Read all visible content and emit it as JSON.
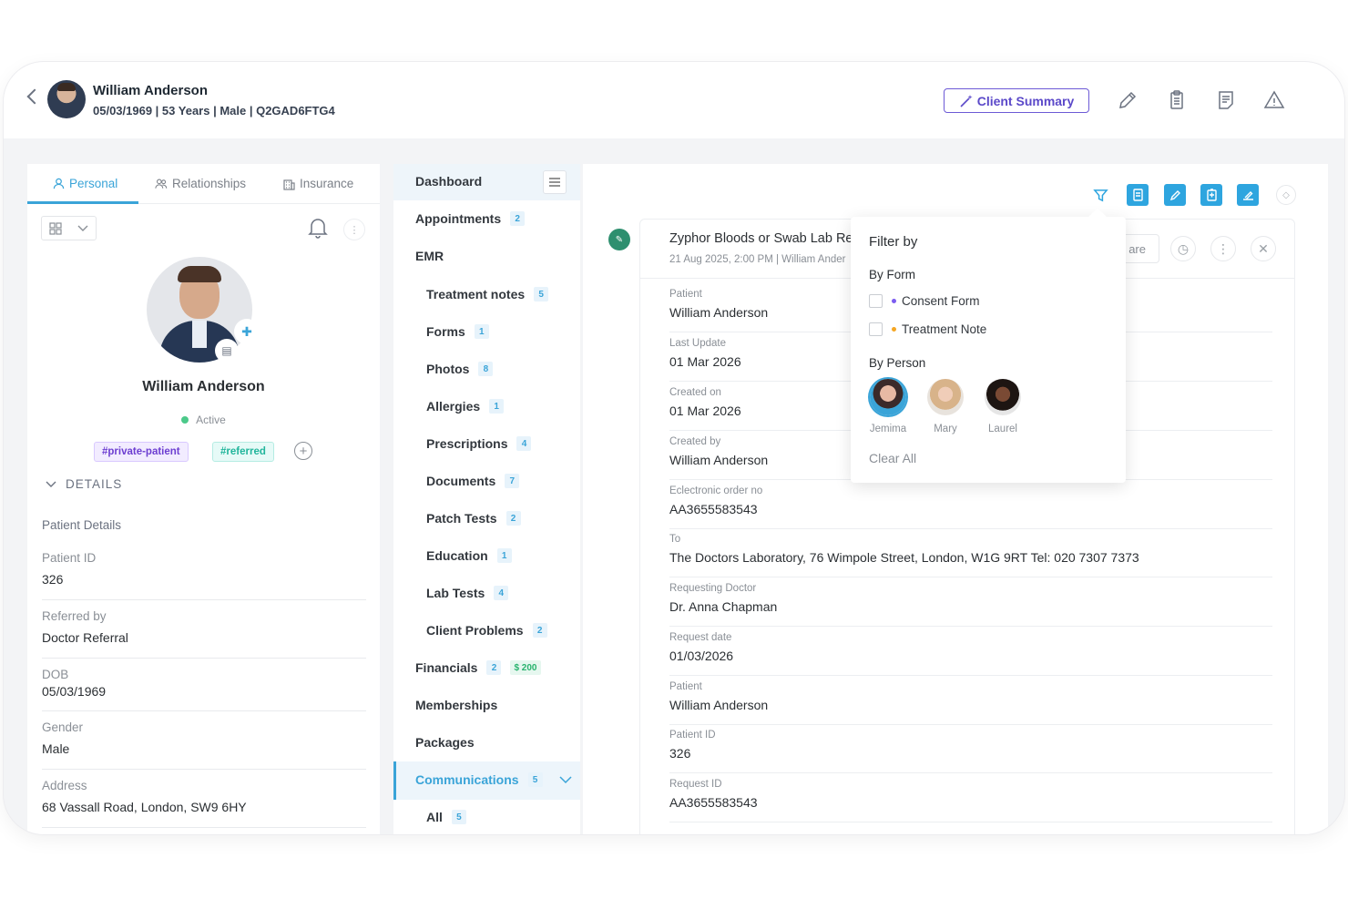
{
  "header": {
    "name": "William Anderson",
    "meta": "05/03/1969 | 53 Years | Male | Q2GAD6FTG4",
    "summary_label": "Client Summary"
  },
  "left": {
    "tabs": [
      "Personal",
      "Relationships",
      "Insurance"
    ],
    "name": "William Anderson",
    "status": "Active",
    "tags": [
      "#private-patient",
      "#referred"
    ],
    "details_heading": "DETAILS",
    "patient_details_title": "Patient Details",
    "fields": [
      {
        "label": "Patient ID",
        "value": "326"
      },
      {
        "label": "Referred by",
        "value": "Doctor Referral"
      },
      {
        "label": "DOB",
        "value": "05/03/1969"
      },
      {
        "label": "Gender",
        "value": "Male"
      },
      {
        "label": "Address",
        "value": "68 Vassall Road, London, SW9 6HY"
      }
    ]
  },
  "nav": {
    "dashboard": "Dashboard",
    "appointments": {
      "label": "Appointments",
      "count": "2"
    },
    "emr": "EMR",
    "emr_items": [
      {
        "label": "Treatment notes",
        "count": "5"
      },
      {
        "label": "Forms",
        "count": "1"
      },
      {
        "label": "Photos",
        "count": "8"
      },
      {
        "label": "Allergies",
        "count": "1"
      },
      {
        "label": "Prescriptions",
        "count": "4"
      },
      {
        "label": "Documents",
        "count": "7"
      },
      {
        "label": "Patch Tests",
        "count": "2"
      },
      {
        "label": "Education",
        "count": "1"
      },
      {
        "label": "Lab Tests",
        "count": "4"
      },
      {
        "label": "Client Problems",
        "count": "2"
      }
    ],
    "financials": {
      "label": "Financials",
      "count": "2",
      "amount": "$ 200"
    },
    "memberships": "Memberships",
    "packages": "Packages",
    "communications": {
      "label": "Communications",
      "count": "5"
    },
    "all": {
      "label": "All",
      "count": "5"
    }
  },
  "record": {
    "title": "Zyphor Bloods or Swab Lab Req",
    "subtitle": "21 Aug 2025, 2:00 PM | William Ander",
    "share_label": "are",
    "fields": [
      {
        "label": "Patient",
        "value": "William Anderson"
      },
      {
        "label": "Last Update",
        "value": "01 Mar 2026"
      },
      {
        "label": "Created on",
        "value": "01 Mar 2026"
      },
      {
        "label": "Created by",
        "value": "William Anderson"
      },
      {
        "label": "Eclectronic order no",
        "value": "AA3655583543"
      },
      {
        "label": "To",
        "value": "The Doctors Laboratory, 76 Wimpole Street, London, W1G 9RT Tel: 020 7307 7373"
      },
      {
        "label": "Requesting Doctor",
        "value": "Dr. Anna Chapman"
      },
      {
        "label": "Request date",
        "value": "01/03/2026"
      },
      {
        "label": "Patient",
        "value": "William Anderson"
      },
      {
        "label": "Patient ID",
        "value": "326"
      },
      {
        "label": "Request ID",
        "value": "AA3655583543"
      }
    ]
  },
  "filter": {
    "title": "Filter by",
    "by_form": "By Form",
    "forms": [
      {
        "label": "Consent Form",
        "color": "#7c5cf0"
      },
      {
        "label": "Treatment Note",
        "color": "#f5a623"
      }
    ],
    "by_person": "By Person",
    "people": [
      "Jemima",
      "Mary",
      "Laurel"
    ],
    "clear_label": "Clear All"
  },
  "colors": {
    "accent": "#3aa4d8",
    "summary": "#5b49c9",
    "toolbar": "#2ea5df"
  }
}
